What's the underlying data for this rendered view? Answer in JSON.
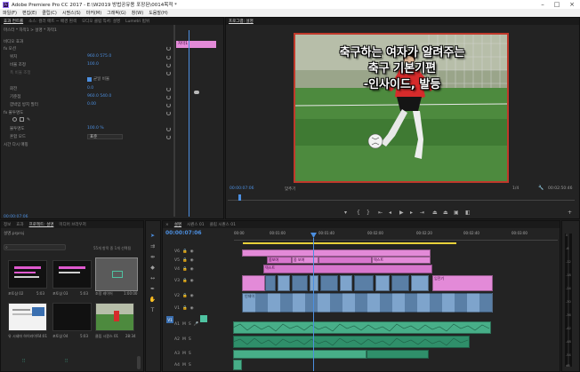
{
  "window": {
    "title": "Adobe Premiere Pro CC 2017 - E:\\W2019 방법공유용 포장된\\0014목적 *"
  },
  "menu": [
    "파일(F)",
    "편집(E)",
    "클립(C)",
    "시퀀스(S)",
    "마커(M)",
    "그래픽(G)",
    "창(W)",
    "도움말(H)"
  ],
  "source_panel": {
    "tabs": [
      "효과 컨트롤",
      "소스: 컬러 매트 ~ 배경 흰색",
      "오디오 클립 믹서: 설명",
      "Lumetri 범위",
      "메타데이터"
    ],
    "source_path": "마스터 * 자막1 > 설명 * 자막1",
    "clip_label": "자막1",
    "rows": [
      {
        "label": "비디오 효과",
        "value": ""
      },
      {
        "label": "fx  모션",
        "value": ""
      },
      {
        "label": "위치",
        "value": "960.0   575.0"
      },
      {
        "label": "비율 조정",
        "value": "100.0"
      },
      {
        "label": "폭 비율 조정",
        "value": ""
      },
      {
        "label": "",
        "value": "균일 비율"
      },
      {
        "label": "회전",
        "value": "0.0"
      },
      {
        "label": "기준점",
        "value": "960.0   540.0"
      },
      {
        "label": "깜박임 방지 필터",
        "value": "0.00"
      },
      {
        "label": "fx  불투명도",
        "value": ""
      },
      {
        "label": "",
        "value": ""
      },
      {
        "label": "불투명도",
        "value": "100.0 %"
      },
      {
        "label": "혼합 모드",
        "value": "표준"
      },
      {
        "label": "시간 다시 매핑",
        "value": ""
      }
    ],
    "timecode": "00:00:07:06"
  },
  "program_monitor": {
    "tab": "프로그램: 설명",
    "overlay_lines": [
      "축구하는 여자가 알려주는",
      "축구 기본기편",
      "-인사이드, 발등"
    ],
    "timecode": "00:00:07:06",
    "fit": "맞추기",
    "ratio": "1/4",
    "duration": "00:02:50:46"
  },
  "project_panel": {
    "tabs": [
      "프로젝트: 설명",
      "미디어 브라우저",
      "라이브러리",
      "정보",
      "효과"
    ],
    "active_tab": "프로젝트: 설명",
    "project_name": "설명.prproj",
    "item_count": "55개 항목 중 1개 선택됨",
    "items": [
      {
        "name": "포토샵 02",
        "duration": "5:03"
      },
      {
        "name": "포토샵 03",
        "duration": "5:03"
      },
      {
        "name": "조정 레이어",
        "duration": "1:00:00"
      },
      {
        "name": "유 시네마 하이라이트",
        "duration": "4:01"
      },
      {
        "name": "포토샵 04",
        "duration": "5:03"
      },
      {
        "name": "클립 시퀀스 01",
        "duration": "28:34"
      }
    ]
  },
  "timeline": {
    "tabs": [
      "설명",
      "시퀀스 01",
      "클립 시퀀스 01"
    ],
    "active_tab": "설명",
    "timecode": "00:00:07:06",
    "ruler": [
      "00:00",
      "00:01:00",
      "00:01:40",
      "00:02:00",
      "00:02:20",
      "00:02:40",
      "00:03:00"
    ],
    "tracks": [
      "V6",
      "V5",
      "V4",
      "V3",
      "V2",
      "V1",
      "A1",
      "A2",
      "A3",
      "A4"
    ],
    "clip_labels": [
      "몸보여",
      "몸 보여",
      "텍스트",
      "텍스트",
      "입전기",
      "인데이"
    ]
  },
  "meter_scale": [
    "0",
    "-6",
    "-12",
    "-18",
    "-24",
    "-30",
    "-36",
    "-42",
    "-48",
    "-54",
    "dB"
  ]
}
